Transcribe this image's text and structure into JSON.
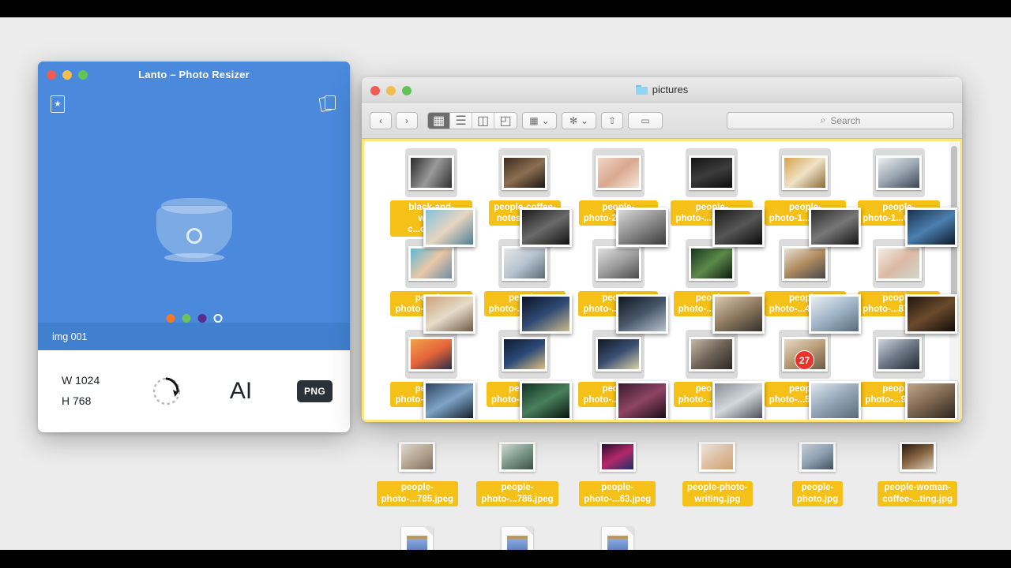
{
  "lanto": {
    "title": "Lanto – Photo Resizer",
    "window_controls": [
      "close",
      "minimize",
      "zoom"
    ],
    "icons": {
      "favorite": "star-book-icon",
      "stack": "copy-stack-icon",
      "jar": "jar-logo-icon"
    },
    "pager_dots": [
      {
        "name": "dot-orange",
        "color": "#f07a27",
        "active": false
      },
      {
        "name": "dot-green",
        "color": "#6cc35b",
        "active": false
      },
      {
        "name": "dot-purple",
        "color": "#5b2d91",
        "active": false
      },
      {
        "name": "dot-white",
        "color": "#ffffff",
        "active": true
      }
    ],
    "file_label": "img 001",
    "footer": {
      "width_label": "W 1024",
      "height_label": "H 768",
      "rotate_icon": "rotate-icon",
      "text_icon": "text-tool-icon",
      "text_icon_glyph": "AI",
      "format_button": "PNG"
    }
  },
  "finder": {
    "title": "pictures",
    "window_controls": [
      "close",
      "minimize",
      "zoom"
    ],
    "toolbar": {
      "back": "‹",
      "forward": "›",
      "view_modes": [
        {
          "name": "icon-view",
          "glyph": "▦",
          "active": true
        },
        {
          "name": "list-view",
          "glyph": "☰",
          "active": false
        },
        {
          "name": "column-view",
          "glyph": "◫",
          "active": false
        },
        {
          "name": "gallery-view",
          "glyph": "◰",
          "active": false
        }
      ],
      "arrange_button": "▦",
      "action_button": "✻",
      "share_button": "⇧",
      "tag_button": "▭",
      "dropdown_caret": "⌄"
    },
    "search": {
      "placeholder": "Search",
      "value": "",
      "icon": "search-icon"
    },
    "drag": {
      "badge_count": "27",
      "cursor": "arrow-cursor"
    },
    "scrollbar": {
      "name": "vertical-scrollbar"
    },
    "files": [
      {
        "name": "black-and-\nwhite-c...ople.jpg",
        "line1": "black-and-",
        "line2": "white-c...ople.jpg"
      },
      {
        "name": "people-coffee-\nnotes-tea.jpg",
        "line1": "people-coffee-",
        "line2": "notes-tea.jpg"
      },
      {
        "name": "people-\nphoto-28462.jpg",
        "line1": "people-",
        "line2": "photo-28462.jpg"
      },
      {
        "name": "people-\nphoto-...807.jpeg",
        "line1": "people-",
        "line2": "photo-...807.jpeg"
      },
      {
        "name": "people-\nphoto-1...44.jpeg",
        "line1": "people-",
        "line2": "photo-1...44.jpeg"
      },
      {
        "name": "people-\nphoto-1...07.jpeg",
        "line1": "people-",
        "line2": "photo-1...07.jpeg"
      },
      {
        "name": "people-\nphoto-...223.jpeg",
        "line1": "people-",
        "line2": "photo-...223.jpeg"
      },
      {
        "name": "people-\nphoto-...087.jpeg",
        "line1": "people-",
        "line2": "photo-...087.jpeg"
      },
      {
        "name": "people-\nphoto-...87a.png",
        "line1": "people-",
        "line2": "photo-...87a.png"
      },
      {
        "name": "people-\nphoto-...44.jpeg",
        "line1": "people-",
        "line2": "photo-...44.jpeg"
      },
      {
        "name": "people-\nphoto-...477.jpeg",
        "line1": "people-",
        "line2": "photo-...477.jpeg"
      },
      {
        "name": "people-\nphoto-...878.jpeg",
        "line1": "people-",
        "line2": "photo-...878.jpeg"
      },
      {
        "name": "people-\nphoto-...769.jpeg",
        "line1": "people-",
        "line2": "photo-...769.jpeg"
      },
      {
        "name": "people-\nphoto-...80.jpeg",
        "line1": "people-",
        "line2": "photo-...80.jpeg"
      },
      {
        "name": "people-\nphoto-...80a.png",
        "line1": "people-",
        "line2": "photo-...80a.png"
      },
      {
        "name": "people-\nphoto-...88.jpeg",
        "line1": "people-",
        "line2": "photo-...88.jpeg"
      },
      {
        "name": "people-\nphoto-...553.jpeg",
        "line1": "people-",
        "line2": "photo-...553.jpeg"
      },
      {
        "name": "people-\nphoto-...90.jpeg",
        "line1": "people-",
        "line2": "photo-...90.jpeg"
      }
    ]
  },
  "desktop": {
    "icons": [
      {
        "line1": "people-",
        "line2": "photo-...785.jpeg"
      },
      {
        "line1": "people-",
        "line2": "photo-...786.jpeg"
      },
      {
        "line1": "people-",
        "line2": "photo-...63.jpeg"
      },
      {
        "line1": "people-photo-",
        "line2": "writing.jpg"
      },
      {
        "line1": "people-",
        "line2": "photo.jpg"
      },
      {
        "line1": "people-woman-",
        "line2": "coffee-...ting.jpg"
      }
    ]
  },
  "colors": {
    "lanto_blue": "#4a89dc",
    "label_yellow": "#f5c018",
    "drop_border": "#ffe477",
    "badge_red": "#e8322a",
    "desktop_gray": "#ececec"
  }
}
